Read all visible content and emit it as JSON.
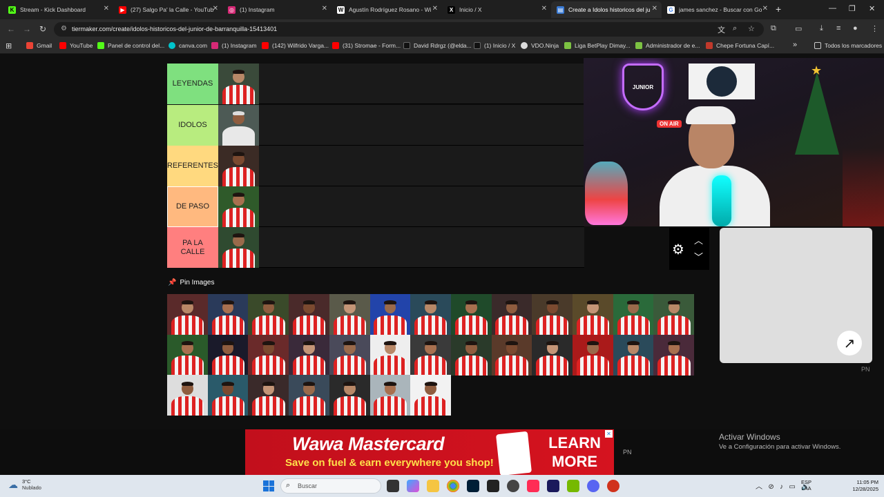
{
  "browser": {
    "tabs": [
      {
        "title": "Stream - Kick Dashboard",
        "fav": "K",
        "color": "#53fc18"
      },
      {
        "title": "(27) Salgo Pa' la Calle - YouTube",
        "fav": "▶",
        "color": "#ff0000"
      },
      {
        "title": "(1) Instagram",
        "fav": "◎",
        "color": "#d62976"
      },
      {
        "title": "Agustín Rodríguez Rosano - Wi",
        "fav": "W",
        "color": "#555555"
      },
      {
        "title": "Inicio / X",
        "fav": "X",
        "color": "#000000"
      },
      {
        "title": "Create a Idolos historicos del ju",
        "fav": "▤",
        "color": "#3a7bd5"
      },
      {
        "title": "james sanchez - Buscar con Go",
        "fav": "G",
        "color": "#4285f4"
      }
    ],
    "new_tab": "+",
    "url": "tiermaker.com/create/idolos-historicos-del-junior-de-barranquilla-15413401",
    "bookmarks": [
      {
        "label": "Gmail",
        "color": "#ea4335"
      },
      {
        "label": "YouTube",
        "color": "#ff0000"
      },
      {
        "label": "Panel de control del...",
        "color": "#53fc18"
      },
      {
        "label": "canva.com",
        "color": "#00c4cc"
      },
      {
        "label": "(1) Instagram",
        "color": "#d62976"
      },
      {
        "label": "(142) Wilfrido Varga...",
        "color": "#ff0000"
      },
      {
        "label": "(31) Stromae - Form...",
        "color": "#ff0000"
      },
      {
        "label": "David Rdrgz (@elda...",
        "color": "#111111"
      },
      {
        "label": "(1) Inicio / X",
        "color": "#111111"
      },
      {
        "label": "VDO.Ninja",
        "color": "#dddddd"
      },
      {
        "label": "Liga BetPlay Dimay...",
        "color": "#7cc242"
      },
      {
        "label": "Administrador de e...",
        "color": "#7cc242"
      },
      {
        "label": "Chepe Fortuna Capí...",
        "color": "#c0392b"
      }
    ],
    "bookmarks_more": "»",
    "all_bookmarks": "Todos los marcadores"
  },
  "tiers": [
    {
      "label": "LEYENDAS",
      "color": "#7fe07f"
    },
    {
      "label": "IDOLOS",
      "color": "#b8ec7f"
    },
    {
      "label": "REFERENTES",
      "color": "#ffd97f"
    },
    {
      "label": "DE PASO",
      "color": "#ffb97f"
    },
    {
      "label": "PA LA CALLE",
      "color": "#ff7f7f"
    }
  ],
  "pin_images_label": "Pin Images",
  "pool_count_note": "",
  "ad": {
    "brand": "Wawa Mastercard",
    "tagline": "Save on fuel & earn everywhere you shop!",
    "cta_line1": "LEARN",
    "cta_line2": "MORE"
  },
  "pn_label": "PN",
  "activate_windows": {
    "title": "Activar Windows",
    "subtitle": "Ve a Configuración para activar Windows."
  },
  "taskbar": {
    "temp": "3°C",
    "weather": "Nublado",
    "search_placeholder": "Buscar",
    "lang_top": "ESP",
    "lang_bottom": "LAA",
    "time": "11:05 PM",
    "date": "12/28/2025"
  }
}
